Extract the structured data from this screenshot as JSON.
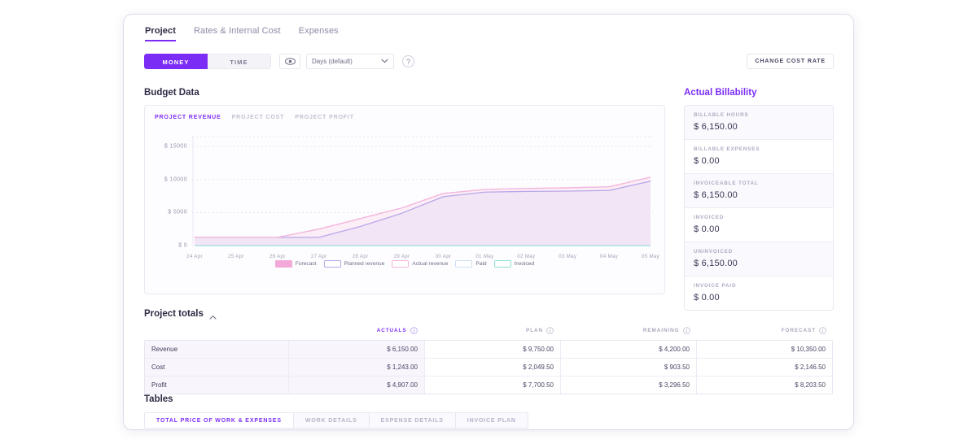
{
  "top_tabs": [
    {
      "label": "Project",
      "active": true
    },
    {
      "label": "Rates & Internal Cost",
      "active": false
    },
    {
      "label": "Expenses",
      "active": false
    }
  ],
  "toolbar": {
    "segment_money": "MONEY",
    "segment_time": "TIME",
    "eye_icon": "eye-icon",
    "select_value": "Days (default)",
    "chevron_icon": "chevron-down-icon",
    "help_icon": "question-mark-icon",
    "change_cost_rate": "CHANGE COST RATE"
  },
  "sections": {
    "budget_data": "Budget Data",
    "actual_billability": "Actual Billability",
    "project_totals": "Project totals",
    "tables": "Tables"
  },
  "chart_tabs": [
    {
      "label": "PROJECT REVENUE",
      "active": true
    },
    {
      "label": "PROJECT COST",
      "active": false
    },
    {
      "label": "PROJECT PROFIT",
      "active": false
    }
  ],
  "billability": [
    {
      "label": "BILLABLE HOURS",
      "value": "$ 6,150.00"
    },
    {
      "label": "BILLABLE EXPENSES",
      "value": "$ 0.00"
    },
    {
      "label": "INVOICEABLE TOTAL",
      "value": "$ 6,150.00"
    },
    {
      "label": "INVOICED",
      "value": "$ 0.00"
    },
    {
      "label": "UNINVOICED",
      "value": "$ 6,150.00"
    },
    {
      "label": "INVOICE PAID",
      "value": "$ 0.00"
    }
  ],
  "totals": {
    "columns": [
      "",
      "ACTUALS",
      "PLAN",
      "REMAINING",
      "FORECAST"
    ],
    "rows": [
      {
        "name": "Revenue",
        "actuals": "$ 6,150.00",
        "plan": "$ 9,750.00",
        "remaining": "$ 4,200.00",
        "forecast": "$ 10,350.00"
      },
      {
        "name": "Cost",
        "actuals": "$ 1,243.00",
        "plan": "$ 2,049.50",
        "remaining": "$ 903.50",
        "forecast": "$ 2,146.50"
      },
      {
        "name": "Profit",
        "actuals": "$ 4,907.00",
        "plan": "$ 7,700.50",
        "remaining": "$ 3,296.50",
        "forecast": "$ 8,203.50"
      }
    ]
  },
  "bottom_tabs": [
    {
      "label": "TOTAL PRICE OF WORK & EXPENSES",
      "active": true
    },
    {
      "label": "WORK DETAILS",
      "active": false
    },
    {
      "label": "EXPENSE DETAILS",
      "active": false
    },
    {
      "label": "INVOICE PLAN",
      "active": false
    }
  ],
  "colors": {
    "accent": "#7b2df5",
    "forecast": "#f2a8d8",
    "planned_revenue": "#b9a7e8",
    "actual_revenue": "#f4b6dd",
    "paid": "#cfe0f5",
    "invoiced": "#8fe0d8",
    "text_dark": "#2f2b45",
    "text_muted": "#a9a6bd"
  },
  "chart_data": {
    "type": "area",
    "title": "Project revenue",
    "xlabel": "",
    "ylabel": "",
    "grid": true,
    "legend_position": "bottom",
    "ylim": [
      0,
      16500
    ],
    "yticks": [
      0,
      5000,
      10000,
      15000
    ],
    "ytick_labels": [
      "$ 0",
      "$ 5000",
      "$ 10000",
      "$ 15000"
    ],
    "x": [
      "24 Apr",
      "25 Apr",
      "26 Apr",
      "27 Apr",
      "28 Apr",
      "29 Apr",
      "30 Apr",
      "01 May",
      "02 May",
      "03 May",
      "04 May",
      "05 May"
    ],
    "series": [
      {
        "name": "Forecast",
        "color": "#f2a8d8",
        "style": "dashed",
        "values": [
          1250,
          1250,
          1250,
          2500,
          4100,
          5700,
          7900,
          8500,
          8650,
          8750,
          8900,
          10350
        ]
      },
      {
        "name": "Planned revenue",
        "color": "#b9a7e8",
        "style": "solid",
        "values": [
          1250,
          1250,
          1250,
          1250,
          2900,
          4900,
          7400,
          8100,
          8200,
          8250,
          8350,
          9750
        ]
      },
      {
        "name": "Actual revenue",
        "color": "#f4b6dd",
        "style": "area",
        "values": [
          1250,
          1250,
          1250,
          2500,
          4100,
          5700,
          7900,
          8500,
          8650,
          8750,
          8900,
          10350
        ]
      },
      {
        "name": "Paid",
        "color": "#cfe0f5",
        "style": "solid",
        "values": [
          0,
          0,
          0,
          0,
          0,
          0,
          0,
          0,
          0,
          0,
          0,
          0
        ]
      },
      {
        "name": "Invoiced",
        "color": "#8fe0d8",
        "style": "solid",
        "values": [
          0,
          0,
          0,
          0,
          0,
          0,
          0,
          0,
          0,
          0,
          0,
          0
        ]
      }
    ]
  }
}
